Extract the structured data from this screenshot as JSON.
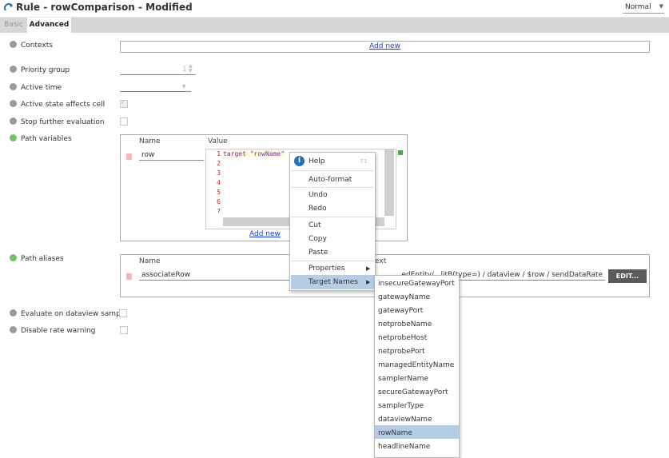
{
  "window": {
    "title": "Rule - rowComparison - Modified",
    "mode": "Normal"
  },
  "tabs": [
    {
      "label": "Basic"
    },
    {
      "label": "Advanced"
    }
  ],
  "fields": {
    "contexts": {
      "label": "Contexts",
      "add_link": "Add new"
    },
    "priority_group": {
      "label": "Priority group",
      "value": "1"
    },
    "active_time": {
      "label": "Active time"
    },
    "active_state": {
      "label": "Active state affects cell"
    },
    "stop_eval": {
      "label": "Stop further evaluation"
    },
    "path_variables": {
      "label": "Path variables",
      "col_name": "Name",
      "col_value": "Value",
      "row_name": "row",
      "code_line": "target \"rowName\"",
      "line_numbers": [
        "1",
        "2",
        "3",
        "4",
        "5",
        "6",
        "7"
      ],
      "add_link": "Add new"
    },
    "path_aliases": {
      "label": "Path aliases",
      "col_name": "Name",
      "col_text": "ext",
      "row_name": "associateRow",
      "row_text": "...edEntity/...litB(type=) / dataview / $row / sendDataRate",
      "edit_button": "EDIT..."
    },
    "eval_sample": {
      "label": "Evaluate on dataview sample"
    },
    "rate_warning": {
      "label": "Disable rate warning"
    }
  },
  "context_menu": {
    "help": "Help",
    "help_shortcut": "F1",
    "items": [
      "Auto-format",
      "Undo",
      "Redo",
      "Cut",
      "Copy",
      "Paste",
      "Properties",
      "Target Names"
    ]
  },
  "target_names": [
    "insecureGatewayPort",
    "gatewayName",
    "gatewayPort",
    "netprobeName",
    "netprobeHost",
    "netprobePort",
    "managedEntityName",
    "samplerName",
    "secureGatewayPort",
    "samplerType",
    "dataviewName",
    "rowName",
    "headlineName"
  ],
  "selected_target": "rowName",
  "colors": {
    "accent": "#1a3fcc",
    "selection": "#b4cde5",
    "status_gray": "#9a9a9a",
    "status_green": "#6ac46a"
  }
}
